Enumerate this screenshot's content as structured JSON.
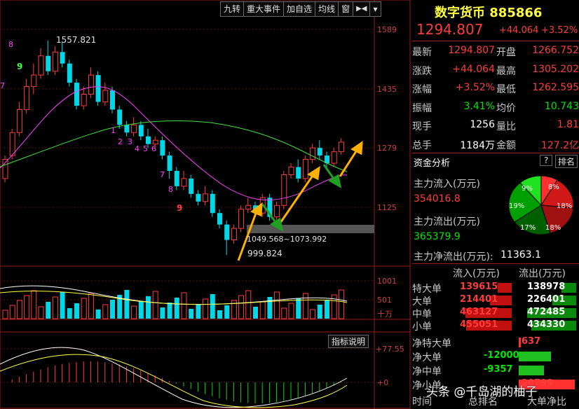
{
  "toolbar": {
    "items": [
      "九转",
      "重大事件",
      "加自选",
      "均线",
      "窗"
    ]
  },
  "chart": {
    "price_axis": [
      "1589",
      "1435",
      "1279",
      "1125"
    ],
    "high_label": "1557.821",
    "low_label": "999.824",
    "range_label": "1049.568~1073.992",
    "nine_marks": [
      "8",
      "9",
      "7",
      "1",
      "2",
      "3",
      "4",
      "5",
      "6",
      "7",
      "8",
      "9"
    ],
    "volume_axis": [
      "1001",
      "501",
      "十万"
    ],
    "macd_axis": [
      "+77.55",
      "+0"
    ],
    "macd_button": "指标说明"
  },
  "quote": {
    "name": "数字货币",
    "code": "885866",
    "price": "1294.807",
    "change": "+44.064",
    "change_pct": "+3.52%",
    "rows": [
      {
        "l1": "最新",
        "v1": "1294.807",
        "l2": "开盘",
        "v2": "1266.752"
      },
      {
        "l1": "涨跌",
        "v1": "+44.064",
        "l2": "最高",
        "v2": "1305.202"
      },
      {
        "l1": "涨幅",
        "v1": "+3.52%",
        "l2": "最低",
        "v2": "1262.595"
      },
      {
        "l1": "振幅",
        "v1": "3.41%",
        "l2": "均价",
        "v2": "10.743"
      },
      {
        "l1": "现手",
        "v1": "1256",
        "l2": "量比",
        "v2": "1.81"
      },
      {
        "l1": "总手",
        "v1": "1184万",
        "l2": "金额",
        "v2": "127.2亿"
      }
    ]
  },
  "capital": {
    "title": "资金分析",
    "help": "?",
    "rank": "排名",
    "inflow_label": "主力流入(万元)",
    "inflow_value": "354016.8",
    "outflow_label": "主力流出(万元)",
    "outflow_value": "365379.9",
    "net_label": "主力净流出(万元):",
    "net_value": "11363.1",
    "pie": [
      "8%",
      "18%",
      "18%",
      "17%",
      "19%",
      "9%"
    ]
  },
  "flows": {
    "header_in": "流入(万元)",
    "header_out": "流出(万元)",
    "rows": [
      {
        "label": "特大单",
        "in": "139615",
        "out": "138978"
      },
      {
        "label": "大单",
        "in": "214401",
        "out": "226401"
      },
      {
        "label": "中单",
        "in": "463127",
        "out": "472485"
      },
      {
        "label": "小单",
        "in": "455051",
        "out": "434330"
      }
    ],
    "net_rows": [
      {
        "label": "净特大单",
        "value": "637"
      },
      {
        "label": "净大单",
        "value": "-12000"
      },
      {
        "label": "净中单",
        "value": "-9357"
      },
      {
        "label": "净小单",
        "value": "20799"
      }
    ],
    "footer": [
      "时间",
      "总排名",
      "大单净比"
    ]
  },
  "watermark": "头条 @千岛湖的柚子"
}
